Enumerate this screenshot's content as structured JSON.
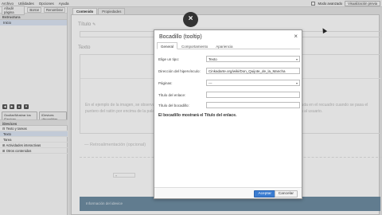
{
  "menu": [
    "Archivo",
    "Utilidades",
    "Opciones",
    "Ayuda"
  ],
  "topright": {
    "advanced_mode": "Modo avanzado",
    "preview_btn": "Visualización previa"
  },
  "left": {
    "toolbar": [
      "Añadir página",
      "Borrar",
      "Renombrar"
    ],
    "structure_head": "Estructura",
    "tree": [
      "Inicio"
    ],
    "buttons": [
      "Ocultar/Mostrar los iDevices",
      "iDevices disponibles"
    ],
    "idev_head": "iDevices",
    "idev_items": [
      "Texto y tareas",
      "Texto",
      "Tarea"
    ],
    "idev_sections": [
      "Actividades interactivas",
      "Otros contenidos"
    ]
  },
  "tabs": [
    "Contenido",
    "Propiedades"
  ],
  "content": {
    "titulo": "Título",
    "texto": "Texto",
    "para": "En el ejemplo de la imagen, se observa un texto donde se ha insertado un tooltip. Puedes ver cómo aparece el texto de ayuda en el recuadro cuando se pasa el puntero del ratón por encima de la palabra resaltada. Puedes usarlo para aclarar conceptos o para ofrecer más información al usuario.",
    "idevice_label": "Retroalimentación (opcional)",
    "footer_text": "Información del idevice"
  },
  "dialog": {
    "title": "Bocadillo (tooltip)",
    "close": "×",
    "tabs": [
      "General",
      "Comportamiento",
      "Apariencia"
    ],
    "fields": [
      {
        "label": "Elige un tipo:",
        "value": "Texto",
        "caret": true
      },
      {
        "label": "Dirección del hipervínculo:",
        "value_prefix": "Cinkadarte.org/wiki/",
        "value_link": "Don_Quijote_de_la_Mancha",
        "caret": false
      },
      {
        "label": "Páginas:",
        "value": "---",
        "caret": true
      },
      {
        "label": "Título del enlace:",
        "value": "",
        "caret": false
      },
      {
        "label": "Título del bocadillo:",
        "value": "",
        "caret": false
      }
    ],
    "note": "El bocadillo mostrará el Título del enlace.",
    "accept": "Aceptar",
    "cancel": "Cancelar"
  },
  "overlay_close": "×"
}
